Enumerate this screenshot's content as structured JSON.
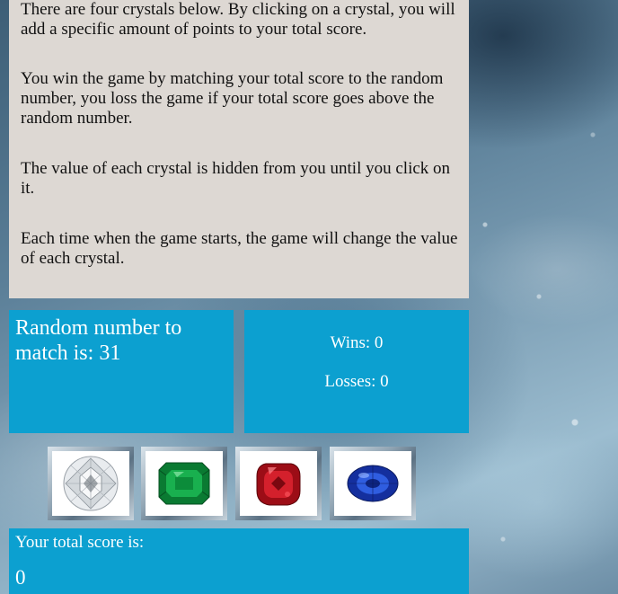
{
  "instructions": {
    "p1": "There are four crystals below. By clicking on a crystal, you will add a specific amount of points to your total score.",
    "p2": "You win the game by matching your total score to the random number, you loss the game if your total score goes above the random number.",
    "p3": "The value of each crystal is hidden from you until you click on it.",
    "p4": "Each time when the game starts, the game will change the value of each crystal."
  },
  "random": {
    "label": "Random number to match is: 31"
  },
  "record": {
    "wins": "Wins: 0",
    "losses": "Losses: 0"
  },
  "crystals": [
    {
      "icon": "diamond-crystal-icon",
      "color": "#c8ccd0"
    },
    {
      "icon": "emerald-crystal-icon",
      "color": "#0d8f3a"
    },
    {
      "icon": "ruby-crystal-icon",
      "color": "#b0101c"
    },
    {
      "icon": "sapphire-crystal-icon",
      "color": "#1c3fb8"
    }
  ],
  "score": {
    "label": "Your total score is:",
    "value": "0"
  },
  "colors": {
    "panel_bg": "#ddd8d3",
    "accent_blue": "#0ca0d0"
  }
}
